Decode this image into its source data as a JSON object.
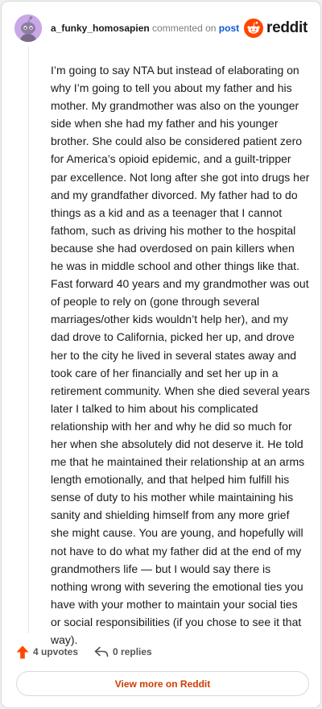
{
  "comment": {
    "author": "a_funky_homosapien",
    "action_text": "commented on",
    "link_text": "post",
    "body": "I’m going to say NTA but instead of elaborating on why I’m going to tell you about my father and his mother. My grandmother was also on the younger side when she had my father and his younger brother. She could also be considered patient zero for America’s opioid epidemic, and a guilt-tripper par excellence. Not long after she got into drugs her and my grandfather divorced. My father had to do things as a kid and as a teenager that I cannot fathom, such as driving his mother to the hospital because she had overdosed on pain killers when he was in middle school and other things like that. Fast forward 40 years and my grandmother was out of people to rely on (gone through several marriages/other kids wouldn’t help her), and my dad drove to California, picked her up, and drove her to the city he lived in several states away and took care of her financially and set her up in a retirement community. When she died several years later I talked to him about his complicated relationship with her and why he did so much for her when she absolutely did not deserve it. He told me that he maintained their relationship at an arms length emotionally, and that helped him fulfill his sense of duty to his mother while maintaining his sanity and shielding himself from any more grief she might cause. You are young, and hopefully will not have to do what my father did at the end of my grandmothers life — but I would say there is nothing wrong with severing the emotional ties you have with your mother to maintain your social ties or social responsibilities (if you chose to see it that way).",
    "upvotes_label": "4 upvotes",
    "replies_label": "0 replies"
  },
  "brand": {
    "name": "reddit",
    "icon": "reddit-logo-icon",
    "color": "#ff4500"
  },
  "cta": {
    "label": "View more on Reddit"
  },
  "colors": {
    "upvote": "#ff4500",
    "link": "#0a5ad6",
    "cta": "#cc3d00"
  },
  "icons": {
    "avatar": "snoo-avatar-icon",
    "upvote": "upvote-arrow-icon",
    "reply": "reply-arrow-icon"
  }
}
